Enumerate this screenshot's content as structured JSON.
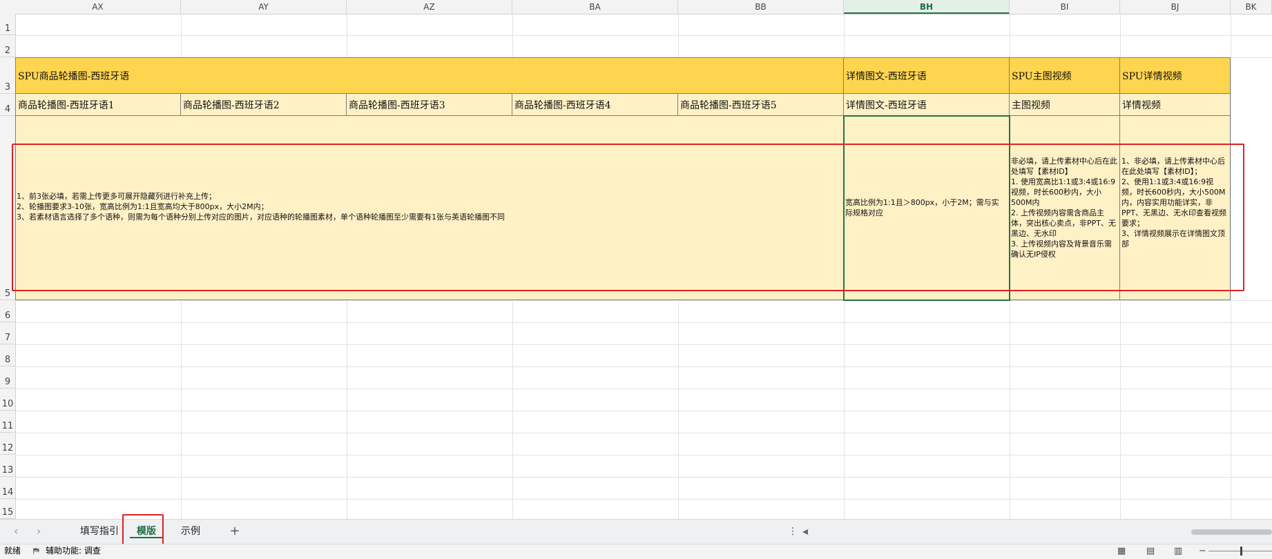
{
  "columns": [
    {
      "label": "AX",
      "selected": false
    },
    {
      "label": "AY",
      "selected": false
    },
    {
      "label": "AZ",
      "selected": false
    },
    {
      "label": "BA",
      "selected": false
    },
    {
      "label": "BB",
      "selected": false
    },
    {
      "label": "BH",
      "selected": true
    },
    {
      "label": "BI",
      "selected": false
    },
    {
      "label": "BJ",
      "selected": false
    },
    {
      "label": "BK",
      "selected": false
    }
  ],
  "rows": [
    "1",
    "2",
    "3",
    "4",
    "5",
    "6",
    "7",
    "8",
    "9",
    "10",
    "11",
    "12",
    "13",
    "14",
    "15"
  ],
  "row3": {
    "spu_carousel": "SPU商品轮播图-西班牙语",
    "detail_image_text": "详情图文-西班牙语",
    "spu_main_video": "SPU主图视频",
    "spu_detail_video": "SPU详情视频"
  },
  "row4": {
    "carousel_1": "商品轮播图-西班牙语1",
    "carousel_2": "商品轮播图-西班牙语2",
    "carousel_3": "商品轮播图-西班牙语3",
    "carousel_4": "商品轮播图-西班牙语4",
    "carousel_5": "商品轮播图-西班牙语5",
    "detail_image_text": "详情图文-西班牙语",
    "main_video": "主图视频",
    "detail_video": "详情视频"
  },
  "row5": {
    "carousel_note": "1、前3张必填，若需上传更多可展开隐藏列进行补充上传；\n2、轮播图要求3-10张，宽高比例为1:1且宽高均大于800px，大小2M内；\n3、若素材语言选择了多个语种，则需为每个语种分别上传对应的图片，对应语种的轮播图素材，单个语种轮播图至少需要有1张与英语轮播图不同",
    "detail_note": "宽高比例为1:1且＞800px，小于2M；需与实际规格对应",
    "main_video_note": "非必填，请上传素材中心后在此处填写【素材ID】\n        1. 使用宽高比1:1或3:4或16:9视频，时长600秒内，大小500M内\n        2. 上传视频内容需含商品主体，突出核心卖点，非PPT、无黑边、无水印\n        3. 上传视频内容及背景音乐需确认无IP侵权",
    "detail_video_note": "1、非必填，请上传素材中心后在此处填写【素材ID】；\n        2、使用1:1或3:4或16:9视频，时长600秒内，大小500M内，内容实用功能详实，非PPT、无黑边、无水印查看视频要求；\n        3、详情视频展示在详情图文顶部"
  },
  "sheet_tabs": [
    {
      "label": "填写指引",
      "active": false
    },
    {
      "label": "模版",
      "active": true
    },
    {
      "label": "示例",
      "active": false
    }
  ],
  "add_sheet_label": "+",
  "status": {
    "ready": "就绪",
    "accessibility": "辅助功能: 调查"
  },
  "colors": {
    "header_orange": "#ffd54f",
    "header_light": "#fff1c6",
    "selection_green": "#217346",
    "highlight_red": "#e02020"
  }
}
